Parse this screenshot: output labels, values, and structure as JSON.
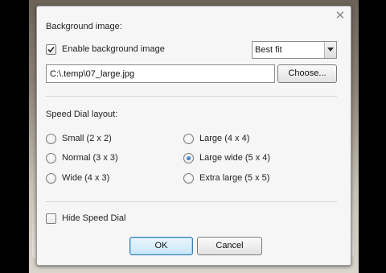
{
  "dialog": {
    "close_icon": "close-icon",
    "background": {
      "section_title": "Background image:",
      "enable_label": "Enable background image",
      "enable_checked": true,
      "fit_value": "Best fit",
      "path_value": "C:\\.temp\\07_large.jpg",
      "choose_label": "Choose..."
    },
    "layout": {
      "section_title": "Speed Dial layout:",
      "options": [
        {
          "label": "Small (2 x 2)",
          "selected": false
        },
        {
          "label": "Large (4 x 4)",
          "selected": false
        },
        {
          "label": "Normal (3 x 3)",
          "selected": false
        },
        {
          "label": "Large wide (5 x 4)",
          "selected": true
        },
        {
          "label": "Wide (4 x 3)",
          "selected": false
        },
        {
          "label": "Extra large (5 x 5)",
          "selected": false
        }
      ]
    },
    "hide_label": "Hide Speed Dial",
    "hide_checked": false,
    "ok_label": "OK",
    "cancel_label": "Cancel"
  }
}
